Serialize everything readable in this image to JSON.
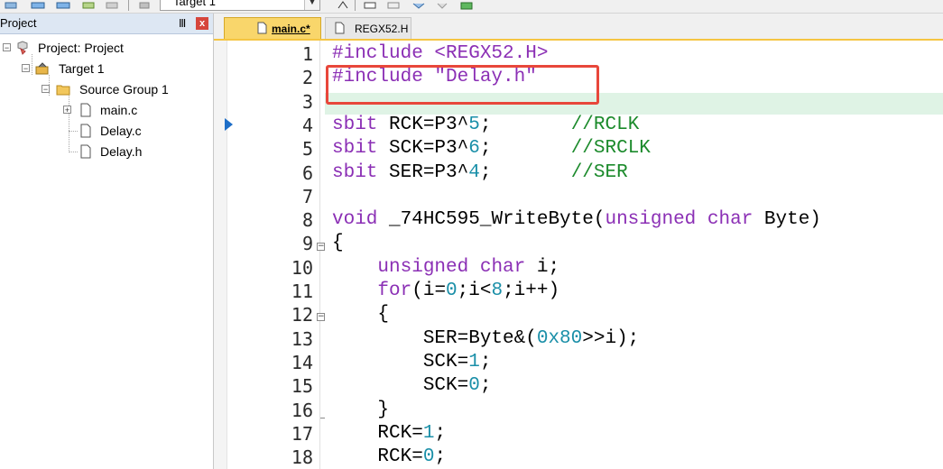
{
  "toolbar": {
    "target_select": "Target 1"
  },
  "project_panel": {
    "title": "Project",
    "pin_glyph": "Ⅲ",
    "close_glyph": "x",
    "tree": {
      "root": "Project: Project",
      "target": "Target 1",
      "group": "Source Group 1",
      "files": [
        "main.c",
        "Delay.c",
        "Delay.h"
      ]
    }
  },
  "tabs": [
    {
      "label": "main.c*",
      "active": true
    },
    {
      "label": "REGX52.H",
      "active": false
    }
  ],
  "editor": {
    "line_numbers": [
      "1",
      "2",
      "3",
      "4",
      "5",
      "6",
      "7",
      "8",
      "9",
      "10",
      "11",
      "12",
      "13",
      "14",
      "15",
      "16",
      "17",
      "18"
    ],
    "lines": [
      [
        {
          "t": "pre",
          "v": "#include <REGX52.H>"
        }
      ],
      [
        {
          "t": "pre",
          "v": "#include "
        },
        {
          "t": "str",
          "v": "\"Delay.h\""
        }
      ],
      [],
      [
        {
          "t": "kw",
          "v": "sbit"
        },
        {
          "t": "txt",
          "v": " RCK=P3^"
        },
        {
          "t": "num",
          "v": "5"
        },
        {
          "t": "txt",
          "v": ";       "
        },
        {
          "t": "cmt",
          "v": "//RCLK"
        }
      ],
      [
        {
          "t": "kw",
          "v": "sbit"
        },
        {
          "t": "txt",
          "v": " SCK=P3^"
        },
        {
          "t": "num",
          "v": "6"
        },
        {
          "t": "txt",
          "v": ";       "
        },
        {
          "t": "cmt",
          "v": "//SRCLK"
        }
      ],
      [
        {
          "t": "kw",
          "v": "sbit"
        },
        {
          "t": "txt",
          "v": " SER=P3^"
        },
        {
          "t": "num",
          "v": "4"
        },
        {
          "t": "txt",
          "v": ";       "
        },
        {
          "t": "cmt",
          "v": "//SER"
        }
      ],
      [],
      [
        {
          "t": "kw",
          "v": "void"
        },
        {
          "t": "txt",
          "v": " _74HC595_WriteByte("
        },
        {
          "t": "kw",
          "v": "unsigned char"
        },
        {
          "t": "txt",
          "v": " Byte)"
        }
      ],
      [
        {
          "t": "txt",
          "v": "{"
        }
      ],
      [
        {
          "t": "txt",
          "v": "    "
        },
        {
          "t": "kw",
          "v": "unsigned char"
        },
        {
          "t": "txt",
          "v": " i;"
        }
      ],
      [
        {
          "t": "txt",
          "v": "    "
        },
        {
          "t": "kw",
          "v": "for"
        },
        {
          "t": "txt",
          "v": "(i="
        },
        {
          "t": "num",
          "v": "0"
        },
        {
          "t": "txt",
          "v": ";i<"
        },
        {
          "t": "num",
          "v": "8"
        },
        {
          "t": "txt",
          "v": ";i++)"
        }
      ],
      [
        {
          "t": "txt",
          "v": "    {"
        }
      ],
      [
        {
          "t": "txt",
          "v": "        SER=Byte&("
        },
        {
          "t": "num",
          "v": "0x80"
        },
        {
          "t": "txt",
          "v": ">>i);"
        }
      ],
      [
        {
          "t": "txt",
          "v": "        SCK="
        },
        {
          "t": "num",
          "v": "1"
        },
        {
          "t": "txt",
          "v": ";"
        }
      ],
      [
        {
          "t": "txt",
          "v": "        SCK="
        },
        {
          "t": "num",
          "v": "0"
        },
        {
          "t": "txt",
          "v": ";"
        }
      ],
      [
        {
          "t": "txt",
          "v": "    }"
        }
      ],
      [
        {
          "t": "txt",
          "v": "    RCK="
        },
        {
          "t": "num",
          "v": "1"
        },
        {
          "t": "txt",
          "v": ";"
        }
      ],
      [
        {
          "t": "txt",
          "v": "    RCK="
        },
        {
          "t": "num",
          "v": "0"
        },
        {
          "t": "txt",
          "v": ";"
        }
      ]
    ]
  }
}
